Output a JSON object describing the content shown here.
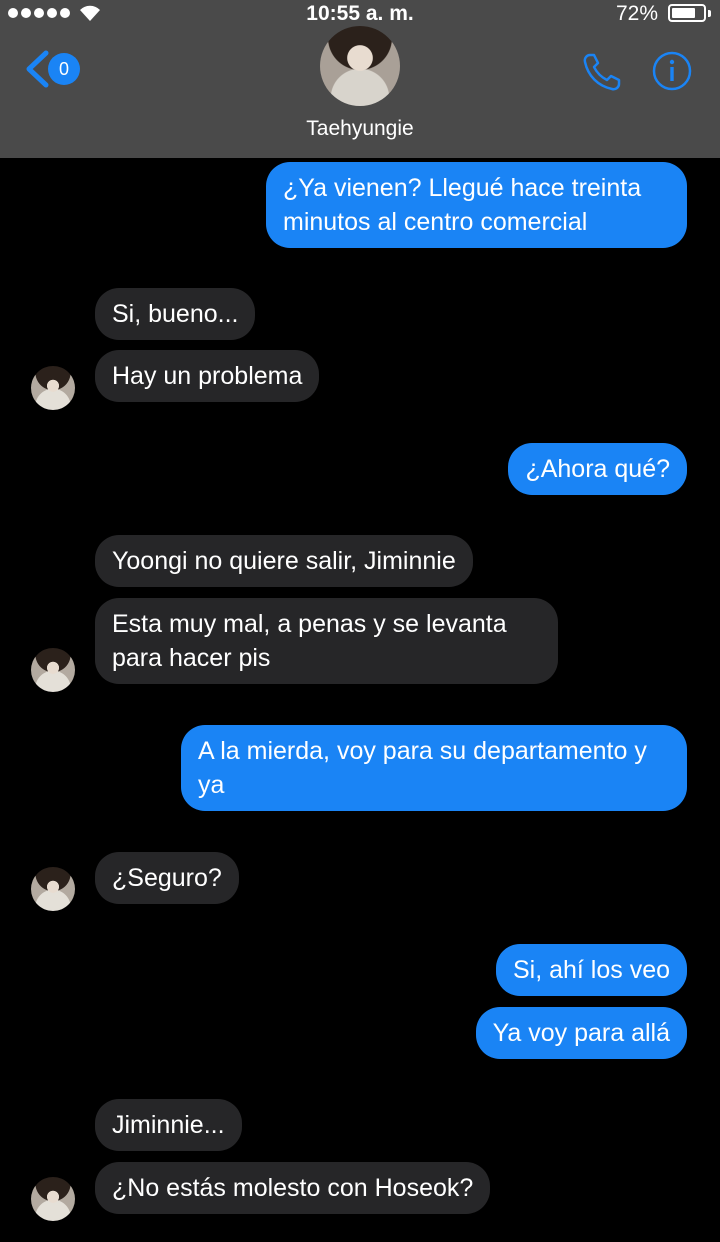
{
  "status_bar": {
    "time": "10:55 a. m.",
    "battery": "72%"
  },
  "header": {
    "contact_name": "Taehyungie",
    "unread_count": "0",
    "back_icon": "chevron-left-icon",
    "call_icon": "phone-icon",
    "info_icon": "info-icon"
  },
  "messages": [
    {
      "from": "me",
      "text": "¿Ya vienen? Llegué hace treinta minutos al centro comercial"
    },
    {
      "from": "them",
      "text": "Si, bueno..."
    },
    {
      "from": "them",
      "text": "Hay un problema"
    },
    {
      "from": "me",
      "text": "¿Ahora qué?"
    },
    {
      "from": "them",
      "text": "Yoongi no quiere salir, Jiminnie"
    },
    {
      "from": "them",
      "text": "Esta muy mal, a penas y se levanta para hacer pis"
    },
    {
      "from": "me",
      "text": "A la mierda, voy para su departamento y ya"
    },
    {
      "from": "them",
      "text": "¿Seguro?"
    },
    {
      "from": "me",
      "text": "Si, ahí los veo"
    },
    {
      "from": "me",
      "text": "Ya voy para allá"
    },
    {
      "from": "them",
      "text": "Jiminnie..."
    },
    {
      "from": "them",
      "text": "¿No estás molesto con Hoseok?"
    }
  ],
  "colors": {
    "header_bg": "#4a4a4a",
    "sent_bubble": "#1a84f5",
    "received_bubble": "#262628",
    "accent": "#1a84f5"
  }
}
